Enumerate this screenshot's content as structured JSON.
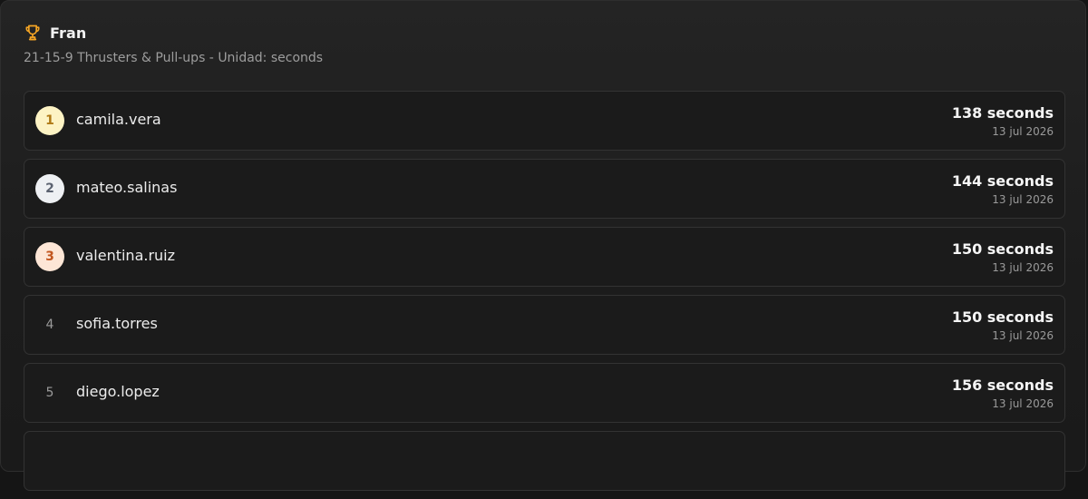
{
  "leaderboard": {
    "icon": "trophy-icon",
    "title": "Fran",
    "subtitle": "21-15-9 Thrusters & Pull-ups - Unidad: seconds",
    "entries": [
      {
        "rank": "1",
        "username": "camila.vera",
        "score": "138 seconds",
        "date": "13 jul 2026"
      },
      {
        "rank": "2",
        "username": "mateo.salinas",
        "score": "144 seconds",
        "date": "13 jul 2026"
      },
      {
        "rank": "3",
        "username": "valentina.ruiz",
        "score": "150 seconds",
        "date": "13 jul 2026"
      },
      {
        "rank": "4",
        "username": "sofia.torres",
        "score": "150 seconds",
        "date": "13 jul 2026"
      },
      {
        "rank": "5",
        "username": "diego.lopez",
        "score": "156 seconds",
        "date": "13 jul 2026"
      }
    ]
  },
  "colors": {
    "accent": "#f5a524",
    "gold": "#fdf3c4",
    "silver": "#eef0f3",
    "bronze": "#fde6d6"
  }
}
